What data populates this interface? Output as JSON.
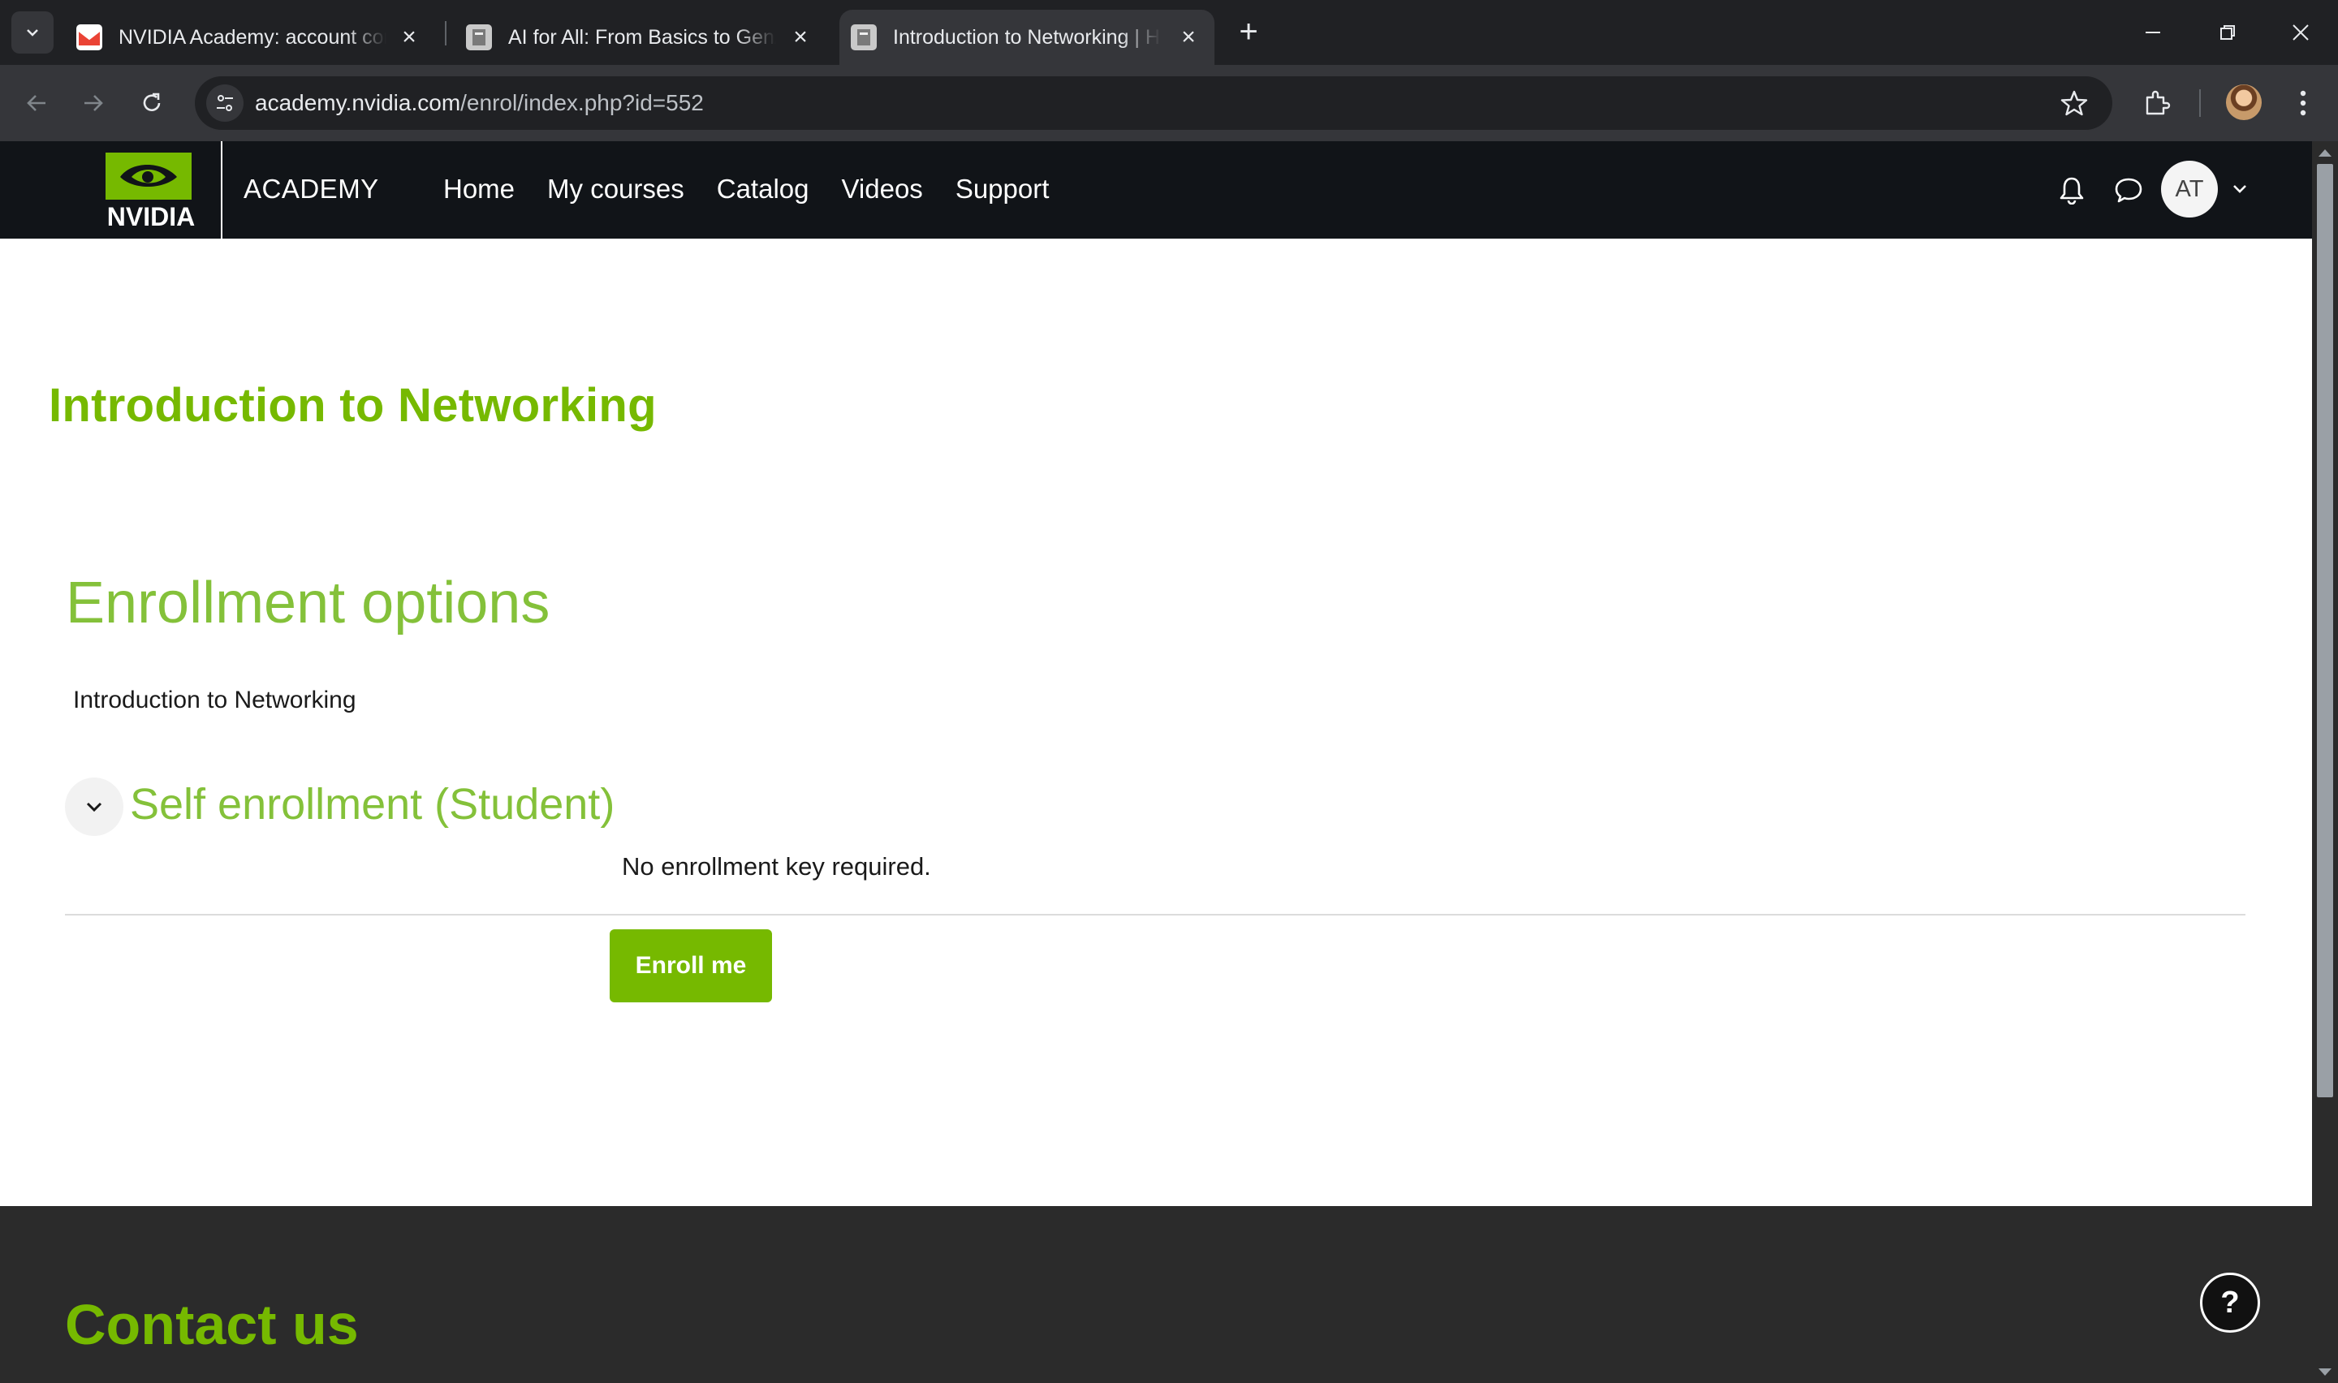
{
  "browser": {
    "tabs": [
      {
        "title": "NVIDIA Academy: account confirmation",
        "favicon": "gmail-icon",
        "active": false
      },
      {
        "title": "AI for All: From Basics to GenAI",
        "favicon": "page-icon",
        "active": false
      },
      {
        "title": "Introduction to Networking | Home",
        "favicon": "page-icon",
        "active": true
      }
    ],
    "url_host": "academy.nvidia.com",
    "url_path": "/enrol/index.php?id=552"
  },
  "site": {
    "logo_text": "NVIDIA",
    "section_name": "ACADEMY",
    "nav": [
      "Home",
      "My courses",
      "Catalog",
      "Videos",
      "Support"
    ],
    "user_initials": "AT",
    "brand_color": "#76b900"
  },
  "page": {
    "course_title": "Introduction to Networking",
    "heading": "Enrollment options",
    "course_name": "Introduction to Networking",
    "method_heading": "Self enrollment (Student)",
    "method_note": "No enrollment key required.",
    "enrol_button": "Enroll me"
  },
  "footer": {
    "contact_heading": "Contact us",
    "help_label": "?"
  }
}
